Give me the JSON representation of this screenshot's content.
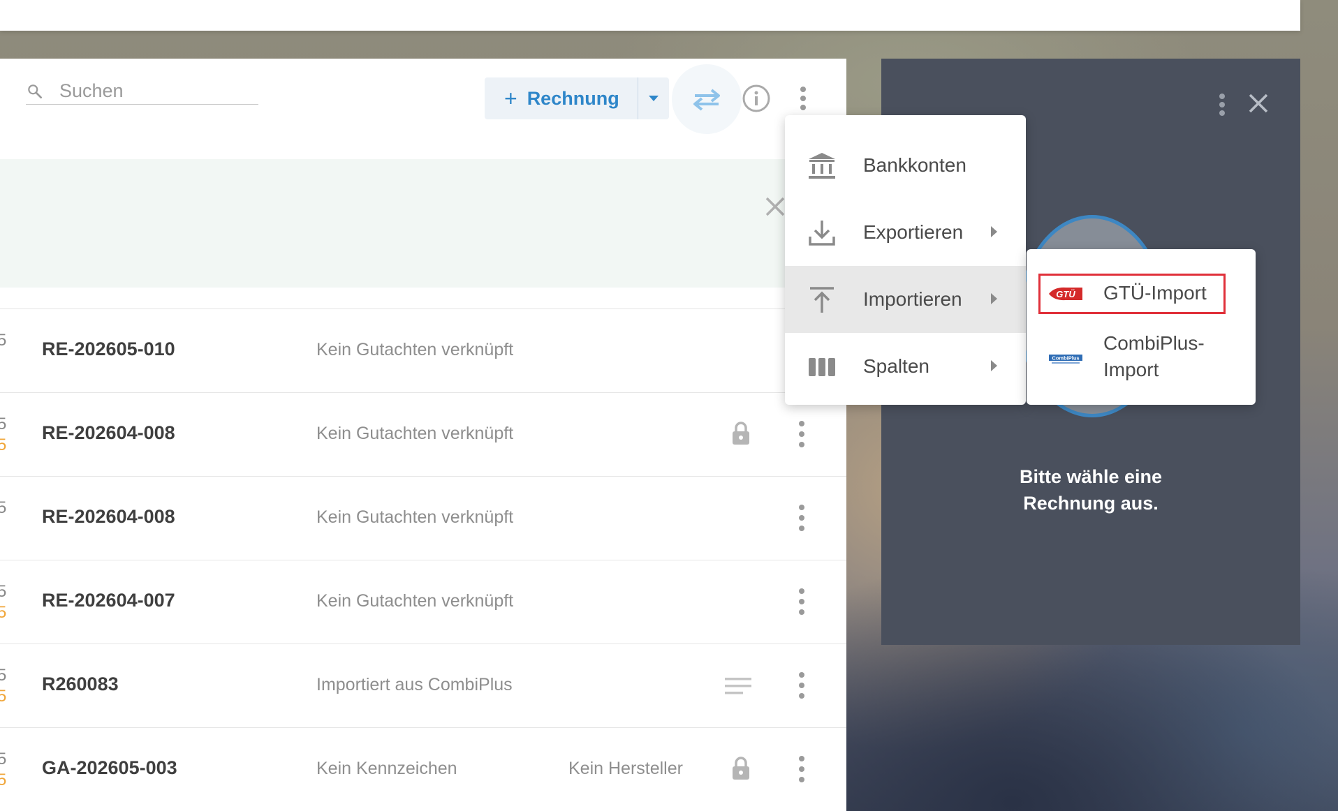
{
  "search": {
    "placeholder": "Suchen"
  },
  "toolbar": {
    "new_invoice_label": "Rechnung"
  },
  "rows": [
    {
      "edge": "5",
      "edge2": "",
      "number": "RE-202605-010",
      "description": "Kein Gutachten verknüpft",
      "description2": "",
      "lock": false,
      "notes": false,
      "menu": false
    },
    {
      "edge": "5",
      "edge2": "5",
      "number": "RE-202604-008",
      "description": "Kein Gutachten verknüpft",
      "description2": "",
      "lock": true,
      "notes": false,
      "menu": true
    },
    {
      "edge": "5",
      "edge2": "",
      "number": "RE-202604-008",
      "description": "Kein Gutachten verknüpft",
      "description2": "",
      "lock": false,
      "notes": false,
      "menu": true
    },
    {
      "edge": "5",
      "edge2": "5",
      "number": "RE-202604-007",
      "description": "Kein Gutachten verknüpft",
      "description2": "",
      "lock": false,
      "notes": false,
      "menu": true
    },
    {
      "edge": "5",
      "edge2": "5",
      "number": "R260083",
      "description": "Importiert aus CombiPlus",
      "description2": "",
      "lock": false,
      "notes": true,
      "menu": true
    },
    {
      "edge": "5",
      "edge2": "5",
      "number": "GA-202605-003",
      "description": "Kein Kennzeichen",
      "description2": "Kein Hersteller",
      "lock": true,
      "notes": false,
      "menu": true
    }
  ],
  "menu": {
    "items": [
      {
        "label": "Bankkonten",
        "icon": "bank-icon",
        "submenu": false
      },
      {
        "label": "Exportieren",
        "icon": "download-icon",
        "submenu": true
      },
      {
        "label": "Importieren",
        "icon": "upload-icon",
        "submenu": true
      },
      {
        "label": "Spalten",
        "icon": "columns-icon",
        "submenu": true
      }
    ]
  },
  "submenu": {
    "items": [
      {
        "label_line1": "GTÜ-Import",
        "label_line2": "",
        "logo": "gtu-logo",
        "logo_text": "GTÜ"
      },
      {
        "label_line1": "CombiPlus-",
        "label_line2": "Import",
        "logo": "combiplus-logo",
        "logo_text": "CombiPlus"
      }
    ]
  },
  "side_panel": {
    "message_line1": "Bitte wähle eine",
    "message_line2": "Rechnung aus."
  },
  "colors": {
    "accent": "#2e86c9",
    "dark_panel": "#4a505d",
    "highlight": "#e0303a",
    "banner": "#f2f7f4"
  }
}
